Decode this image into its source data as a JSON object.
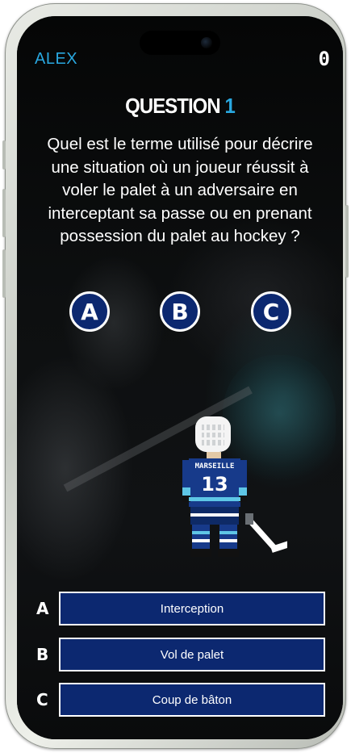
{
  "header": {
    "player_name": "ALEX",
    "score": "0"
  },
  "question": {
    "label": "QUESTION",
    "number": "1",
    "text": "Quel est le terme utilisé pour décrire une situation où un joueur réussit à voler le palet à un adversaire en interceptant sa passe ou en prenant possession du palet au hockey ?"
  },
  "choice_buttons": [
    "A",
    "B",
    "C"
  ],
  "answers": [
    {
      "letter": "A",
      "label": "Interception"
    },
    {
      "letter": "B",
      "label": "Vol de palet"
    },
    {
      "letter": "C",
      "label": "Coup de bâton"
    }
  ],
  "mascot": {
    "jersey_text": "MARSEILLE",
    "jersey_number": "13"
  },
  "colors": {
    "accent": "#29a8e0",
    "button_navy": "#0c2870",
    "background": "#070808"
  }
}
